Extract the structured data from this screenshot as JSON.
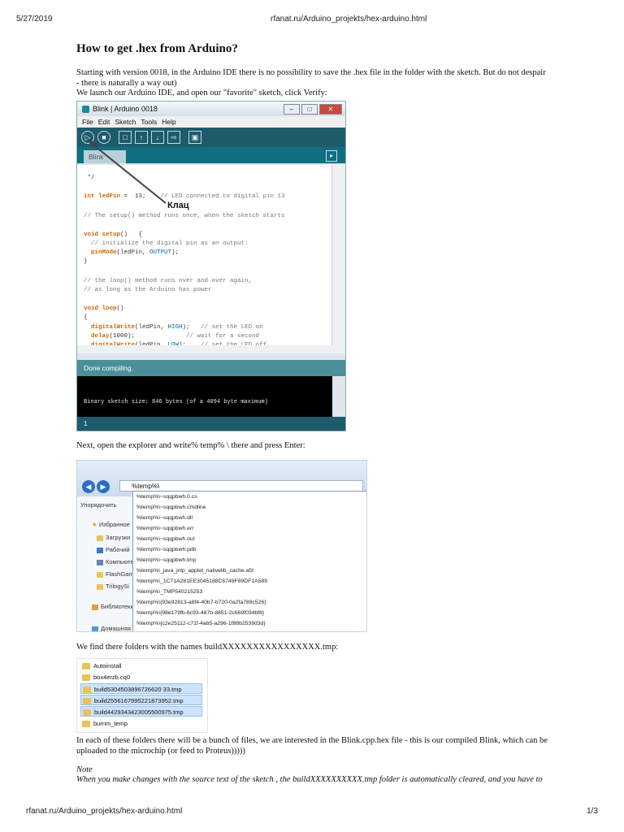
{
  "header": {
    "date": "5/27/2019",
    "url": "rfanat.ru/Arduino_projekts/hex-arduino.html"
  },
  "title": "How to get .hex from Arduino?",
  "para1": "Starting with version 0018, in the Arduino IDE there is no possibility to save the .hex file in the folder with the sketch. But do not despair - there is naturally a way out)",
  "para2": "We launch our Arduino IDE, and open our \"favorite\" sketch, click Verify:",
  "ide": {
    "window_title": "Blink | Arduino 0018",
    "menu": [
      "File",
      "Edit",
      "Sketch",
      "Tools",
      "Help"
    ],
    "toolbar_icons": [
      "verify-icon",
      "stop-icon",
      "new-icon",
      "open-icon",
      "save-icon",
      "upload-icon",
      "serial-monitor-icon"
    ],
    "tab": "Blink",
    "code": {
      "l1": " */",
      "l2_kw": "int ledPin",
      "l2_rest": " =  13;    ",
      "l2_cm": "// LED connected to digital pin 13",
      "l3": "// The setup() method runs once, when the sketch starts",
      "l4_kw": "void setup",
      "l4_rest": "()   {",
      "l5": "  // initialize the digital pin as an output:",
      "l6_fn": "  pinMode",
      "l6_a": "(ledPin, ",
      "l6_c": "OUTPUT",
      "l6_b": ");",
      "l7": "}",
      "l8": "// the loop() method runs over and over again,",
      "l9": "// as long as the Arduino has power",
      "l10_kw": "void loop",
      "l10_rest": "()",
      "l11": "{",
      "l12_fn": "  digitalWrite",
      "l12_a": "(ledPin, ",
      "l12_c": "HIGH",
      "l12_b": ");   ",
      "l12_cm": "// set the LED on",
      "l13_fn": "  delay",
      "l13_a": "(1000);              ",
      "l13_cm": "// wait for a second",
      "l14_fn": "  digitalWrite",
      "l14_a": "(ledPin, ",
      "l14_c": "LOW",
      "l14_b": ");    ",
      "l14_cm": "// set the LED off"
    },
    "status": "Done compiling.",
    "console": "Binary sketch size: 846 bytes (of a 4094 byte maximum)",
    "footer_line": "1",
    "annotation": "Клац"
  },
  "para3": "Next, open the explorer and write% temp% \\ there and press Enter:",
  "explorer": {
    "address": "%temp%\\",
    "sidebar": [
      "Упорядочить",
      "Избранное",
      "Загрузки",
      "Рабочий",
      "Компьютер",
      "FlashGame",
      "TrilogySi",
      "Библиотеки",
      "Домашняя"
    ],
    "options": [
      "%temp%\\~sqqpbwh.0.cs",
      "%temp%\\~sqqpbwh.cmdline",
      "%temp%\\~sqqpbwh.dll",
      "%temp%\\~sqqpbwh.err",
      "%temp%\\~sqqpbwh.out",
      "%temp%\\~sqqpbwh.pdb",
      "%temp%\\~sqqpbwh.tmp",
      "%temp%\\_java_jnlp_applet_nativelib_cache.a5t",
      "%temp%\\_1C71A281EE3045188C6749F89DF1A589",
      "%temp%\\_TMP540215253",
      "%temp%\\{93e92813-a8f4-40b7-b720-0a2fa789c526}",
      "%temp%\\{98e179fb-6c93-487b-8651-2c669f034bf8}",
      "%temp%\\{c2e25112-c71f-4ab5-a296-1f88b2539d3d}"
    ]
  },
  "para4": "We find there folders with the names buildXXXXXXXXXXXXXXXX.tmp:",
  "folders": [
    {
      "name": "Autoinstall",
      "selected": false
    },
    {
      "name": "box4erzb.cq0",
      "selected": false
    },
    {
      "name": "build5304503896726620 33.tmp",
      "selected": true
    },
    {
      "name": "build2556167995221873952.tmp",
      "selected": true
    },
    {
      "name": "build4429343423005500975.tmp",
      "selected": true
    },
    {
      "name": "burnm_temp",
      "selected": false
    }
  ],
  "para5": "In each of these folders there will be a bunch of files, we are interested in the Blink.cpp.hex file - this is our compiled Blink, which can be uploaded to the microchip (or feed to Proteus)))))",
  "note_title": "Note",
  "note_text": "When you make changes with the source text of the sketch , the buildXXXXXXXXXX.tmp folder is automatically cleared, and you have to",
  "footer": {
    "url": "rfanat.ru/Arduino_projekts/hex-arduino.html",
    "page": "1/3"
  }
}
